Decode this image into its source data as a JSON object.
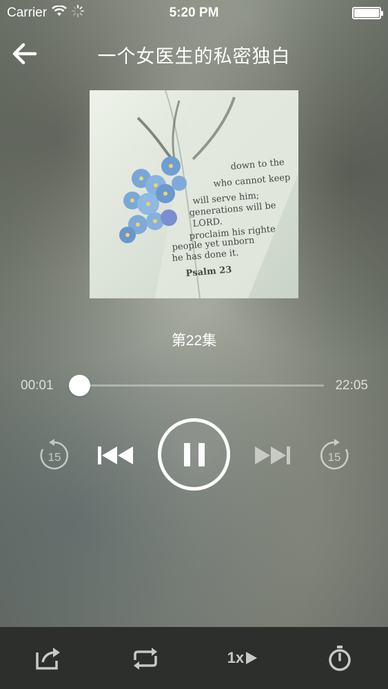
{
  "status_bar": {
    "carrier": "Carrier",
    "time": "5:20 PM",
    "battery_level": 1.0
  },
  "header": {
    "title": "一个女医生的私密独白",
    "back_icon": "arrow-left-icon"
  },
  "cover": {
    "description_icon": "book-flowers-cover",
    "book_lines": [
      "down to the",
      "who cannot keep",
      "will serve him;",
      "generations will be",
      "LORD.",
      "proclaim his righte",
      "people yet unborn",
      "he has done it.",
      "Psalm 23"
    ]
  },
  "episode": {
    "label": "第22集"
  },
  "player": {
    "current_time": "00:01",
    "total_time": "22:05",
    "progress": 0.02,
    "rewind_label": "15",
    "forward_label": "15",
    "state": "playing"
  },
  "bottom_bar": {
    "share_icon": "share-icon",
    "repeat_icon": "repeat-icon",
    "speed_label": "1x",
    "timer_icon": "stopwatch-icon"
  },
  "colors": {
    "bottom_bar_bg": "#2d2f2d",
    "accent": "#ffffff"
  }
}
